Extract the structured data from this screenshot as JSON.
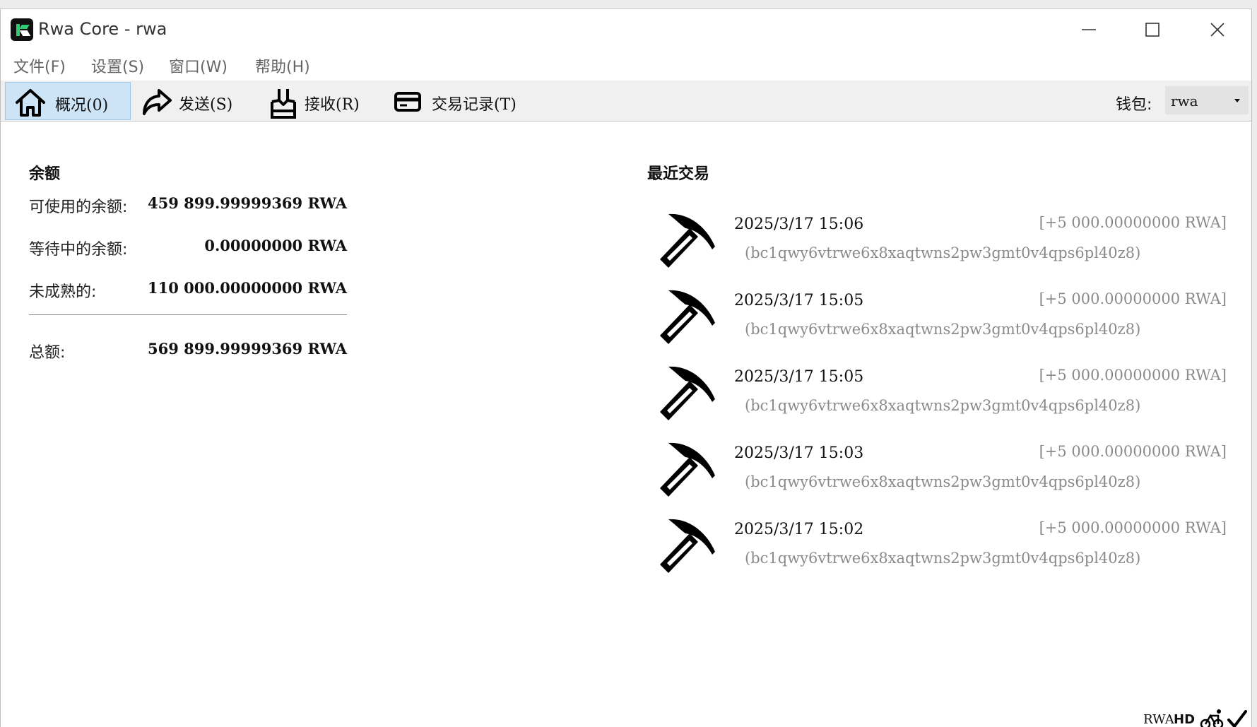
{
  "window": {
    "title": "Rwa Core - rwa"
  },
  "menu": [
    "文件(F)",
    "设置(S)",
    "窗口(W)",
    "帮助(H)"
  ],
  "toolbar": {
    "overview": "概况(0)",
    "send": "发送(S)",
    "receive": "接收(R)",
    "transactions": "交易记录(T)",
    "wallet_label": "钱包:",
    "wallet_value": "rwa"
  },
  "balances": {
    "title": "余额",
    "available_label": "可使用的余额:",
    "available_value": "459 899.99999369 RWA",
    "pending_label": "等待中的余额:",
    "pending_value": "0.00000000 RWA",
    "immature_label": "未成熟的:",
    "immature_value": "110 000.00000000 RWA",
    "total_label": "总额:",
    "total_value": "569 899.99999369 RWA"
  },
  "recent": {
    "title": "最近交易",
    "items": [
      {
        "date": "2025/3/17 15:06",
        "amount": "[+5 000.00000000 RWA]",
        "address": "(bc1qwy6vtrwe6x8xaqtwns2pw3gmt0v4qps6pl40z8)",
        "icon": "pickaxe-icon"
      },
      {
        "date": "2025/3/17 15:05",
        "amount": "[+5 000.00000000 RWA]",
        "address": "(bc1qwy6vtrwe6x8xaqtwns2pw3gmt0v4qps6pl40z8)",
        "icon": "pickaxe-icon"
      },
      {
        "date": "2025/3/17 15:05",
        "amount": "[+5 000.00000000 RWA]",
        "address": "(bc1qwy6vtrwe6x8xaqtwns2pw3gmt0v4qps6pl40z8)",
        "icon": "pickaxe-icon"
      },
      {
        "date": "2025/3/17 15:03",
        "amount": "[+5 000.00000000 RWA]",
        "address": "(bc1qwy6vtrwe6x8xaqtwns2pw3gmt0v4qps6pl40z8)",
        "icon": "pickaxe-icon"
      },
      {
        "date": "2025/3/17 15:02",
        "amount": "[+5 000.00000000 RWA]",
        "address": "(bc1qwy6vtrwe6x8xaqtwns2pw3gmt0v4qps6pl40z8)",
        "icon": "pickaxe-icon"
      }
    ]
  },
  "status": {
    "unit": "RWA",
    "hd": "HD"
  },
  "colors": {
    "active_tab_bg": "#cde4f7",
    "muted_text": "#8a8a8a",
    "logo_accent": "#2ecc71"
  }
}
